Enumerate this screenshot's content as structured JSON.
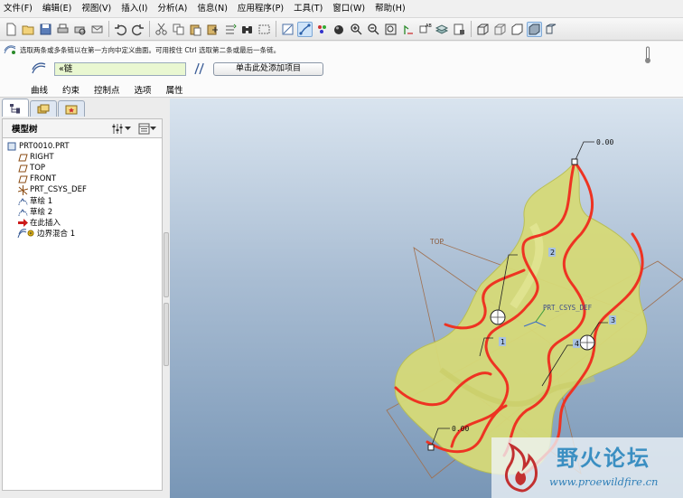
{
  "menu": {
    "items": [
      "文件(F)",
      "编辑(E)",
      "视图(V)",
      "插入(I)",
      "分析(A)",
      "信息(N)",
      "应用程序(P)",
      "工具(T)",
      "窗口(W)",
      "帮助(H)"
    ]
  },
  "toolbar": {
    "icons": [
      "new-icon",
      "open-icon",
      "save-icon",
      "print-icon",
      "print-preview-icon",
      "email-icon",
      "undo-icon",
      "redo-icon",
      "cut-icon",
      "copy-icon",
      "paste-icon",
      "paste-special-icon",
      "regenerate-icon",
      "find-icon",
      "select-box-icon",
      "repaint-icon",
      "spin-center-icon",
      "orient-icon",
      "saved-views-icon",
      "zoom-in-icon",
      "zoom-out-icon",
      "refit-icon",
      "reorient-icon",
      "view-manager-icon",
      "layers-icon",
      "model-display-icon",
      "wireframe-icon",
      "hidden-line-icon",
      "no-hidden-icon",
      "shading-icon",
      "datum-display-icon"
    ]
  },
  "dashboard": {
    "message": "选取两条或多条链以在第一方向中定义曲面。可用按住 Ctrl 选取第二条或最后一条链。",
    "chain_value": "«链",
    "add_item_label": "单击此处添加项目",
    "tabs": [
      "曲线",
      "约束",
      "控制点",
      "选项",
      "属性"
    ]
  },
  "model_tree": {
    "title": "模型树",
    "nodes": [
      {
        "label": "PRT0010.PRT",
        "icon": "part-icon"
      },
      {
        "label": "RIGHT",
        "icon": "datum-plane-icon"
      },
      {
        "label": "TOP",
        "icon": "datum-plane-icon"
      },
      {
        "label": "FRONT",
        "icon": "datum-plane-icon"
      },
      {
        "label": "PRT_CSYS_DEF",
        "icon": "coordinate-system-icon"
      },
      {
        "label": "草绘 1",
        "icon": "sketch-icon"
      },
      {
        "label": "草绘 2",
        "icon": "sketch-icon"
      },
      {
        "label": "在此插入",
        "icon": "insert-here-arrow-icon"
      },
      {
        "label": "边界混合 1",
        "icon": "boundary-blend-icon"
      }
    ]
  },
  "viewport": {
    "labels": {
      "dim_top": "0.00",
      "dim_bottom": "0.00",
      "handle_1": "1",
      "handle_2": "2",
      "handle_3": "3",
      "handle_4": "4",
      "plane_top": "TOP",
      "csys": "PRT_CSYS_DEF"
    },
    "colors": {
      "surface": "#d8dc7a",
      "curve": "#ee3322",
      "background_top": "#d9e4ef",
      "background_bottom": "#7896b6"
    }
  },
  "watermark": {
    "text": "野火论坛",
    "url": "www.proewildfire.cn"
  }
}
